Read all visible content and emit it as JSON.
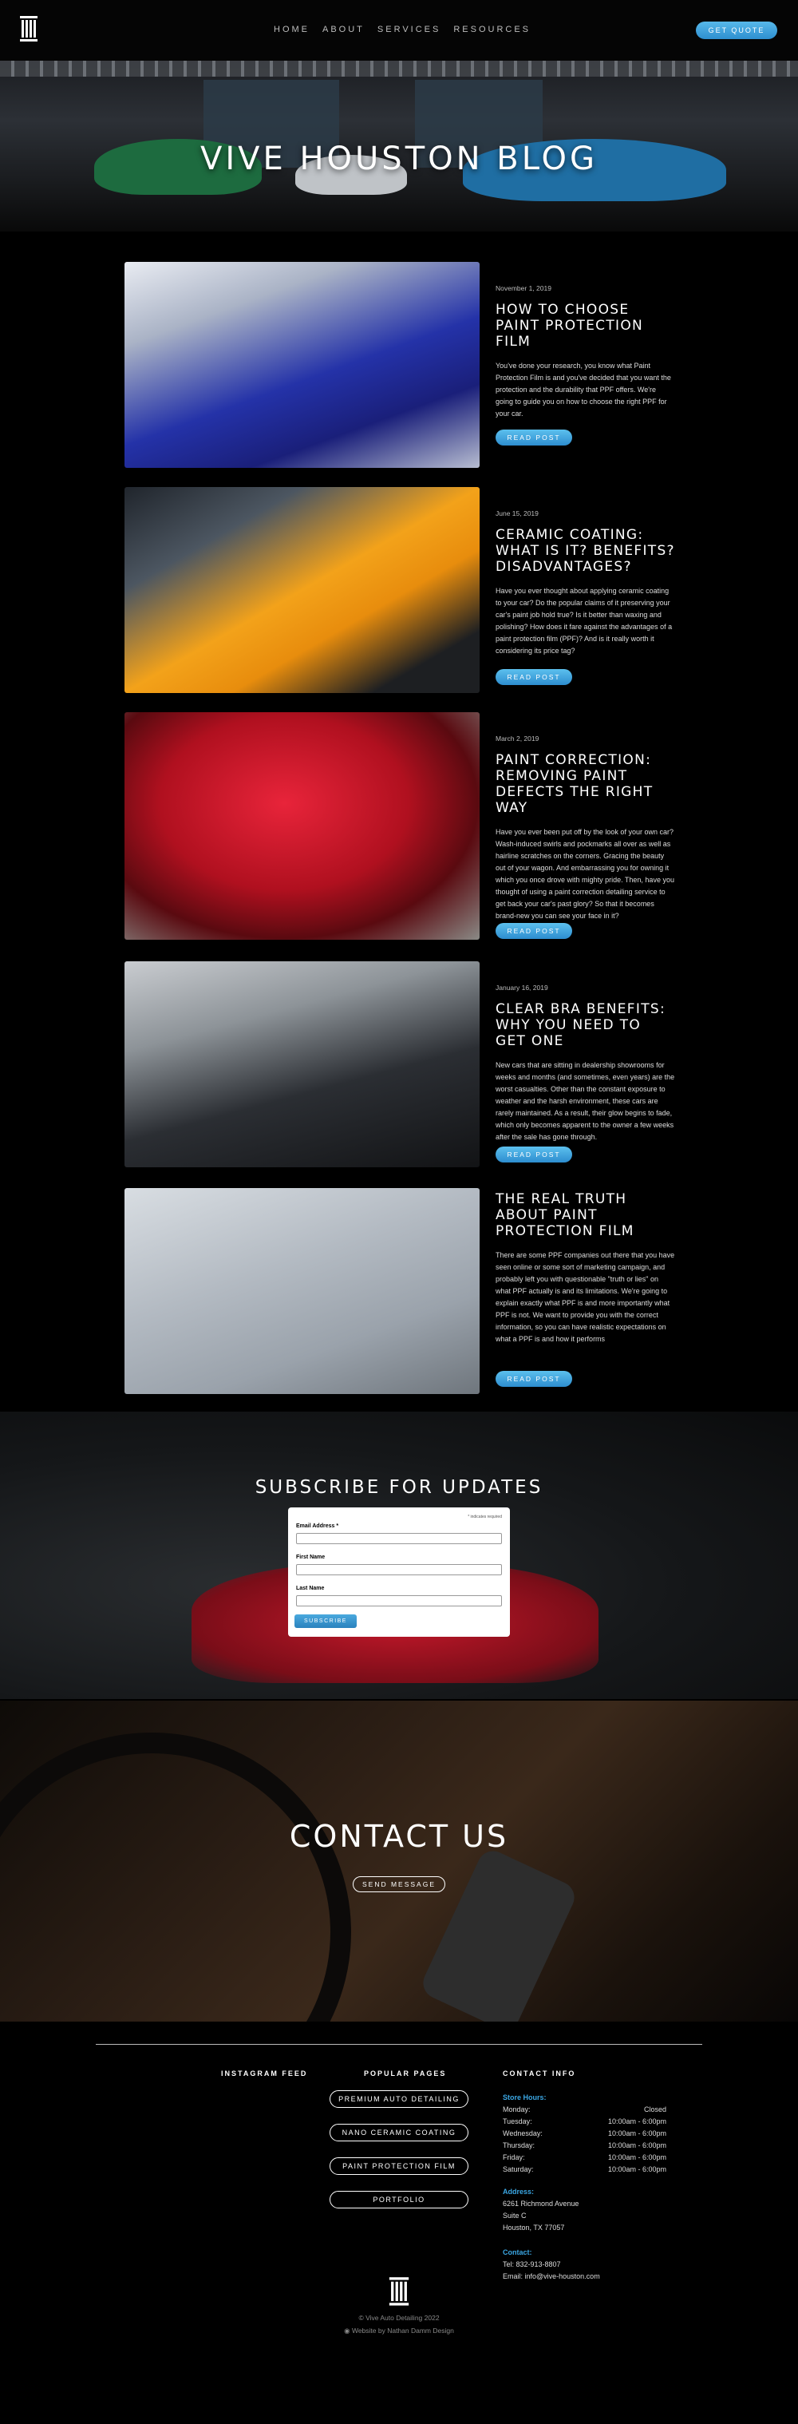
{
  "nav": {
    "items": [
      "HOME",
      "ABOUT",
      "SERVICES",
      "RESOURCES"
    ],
    "quote_label": "GET QUOTE"
  },
  "hero": {
    "title": "VIVE HOUSTON BLOG"
  },
  "posts": [
    {
      "date": "November 1, 2019",
      "title": "HOW TO CHOOSE PAINT PROTECTION FILM",
      "excerpt": "You've done your research, you know what Paint Protection Film is and you've decided that you want the protection and the durability that PPF offers. We're going to guide you on how to choose the right PPF for your car.",
      "button": "READ POST"
    },
    {
      "date": "June 15, 2019",
      "title": "CERAMIC COATING: WHAT IS IT? BENEFITS? DISADVANTAGES?",
      "excerpt": "Have you ever thought about applying ceramic coating to your car? Do the popular claims of it preserving your car's paint job hold true? Is it better than waxing and polishing? How does it fare against the advantages of a paint protection film (PPF)? And is it really worth it considering its price tag?",
      "button": "READ POST"
    },
    {
      "date": "March 2, 2019",
      "title": "PAINT CORRECTION: REMOVING PAINT DEFECTS THE RIGHT WAY",
      "excerpt": "Have you ever been put off by the look of your own car? Wash-induced swirls and pockmarks all over as well as hairline scratches on the corners. Gracing the beauty out of your wagon. And embarrassing you for owning it which you once drove with mighty pride. Then, have you thought of using a paint correction detailing service to get back your car's past glory? So that it becomes brand-new you can see your face in it?",
      "button": "READ POST"
    },
    {
      "date": "January 16, 2019",
      "title": "CLEAR BRA BENEFITS: WHY YOU NEED TO GET ONE",
      "excerpt": "New cars that are sitting in dealership showrooms for weeks and months (and sometimes, even years) are the worst casualties. Other than the constant exposure to weather and the harsh environment, these cars are rarely maintained. As a result, their glow begins to fade, which only becomes apparent to the owner a few weeks after the sale has gone through.",
      "button": "READ POST"
    },
    {
      "date": "",
      "title": "THE REAL TRUTH ABOUT PAINT PROTECTION FILM",
      "excerpt": "There are some PPF companies out there that you have seen online or some sort of marketing campaign, and probably left you with questionable \"truth or lies\" on what PPF actually is and its limitations. We're going to explain exactly what PPF is and more importantly what PPF is not. We want to provide you with the correct information, so you can have realistic expectations on what a PPF is and how it performs",
      "button": "READ POST"
    }
  ],
  "subscribe": {
    "title": "SUBSCRIBE FOR UPDATES",
    "required_note": "* indicates required",
    "email_label": "Email Address *",
    "first_label": "First Name",
    "last_label": "Last Name",
    "button": "SUBSCRIBE"
  },
  "contact": {
    "title": "CONTACT US",
    "button": "SEND MESSAGE"
  },
  "footer": {
    "instagram_heading": "INSTAGRAM FEED",
    "popular_heading": "POPULAR PAGES",
    "contact_heading": "CONTACT INFO",
    "pages": [
      "PREMIUM AUTO DETAILING",
      "NANO CERAMIC COATING",
      "PAINT PROTECTION FILM",
      "PORTFOLIO"
    ],
    "hours_label": "Store Hours:",
    "hours": [
      {
        "day": "Monday:",
        "time": "Closed"
      },
      {
        "day": "Tuesday:",
        "time": "10:00am - 6:00pm"
      },
      {
        "day": "Wednesday:",
        "time": "10:00am - 6:00pm"
      },
      {
        "day": "Thursday:",
        "time": "10:00am - 6:00pm"
      },
      {
        "day": "Friday:",
        "time": "10:00am - 6:00pm"
      },
      {
        "day": "Saturday:",
        "time": "10:00am - 6:00pm"
      }
    ],
    "address_label": "Address:",
    "address": [
      "6261 Richmond Avenue",
      "Suite C",
      "Houston, TX 77057"
    ],
    "contact_label": "Contact:",
    "phone": "Tel: 832-913-8807",
    "email": "Email: info@vive-houston.com",
    "copyright": "© Vive Auto Detailing 2022",
    "credit": "Website by Nathan Damm Design"
  },
  "colors": {
    "accent": "#3ba7e4",
    "background": "#000000"
  }
}
